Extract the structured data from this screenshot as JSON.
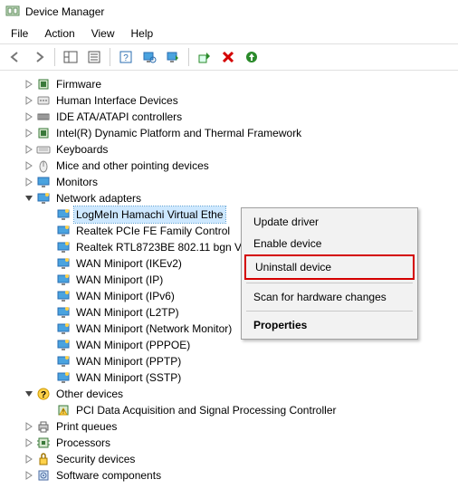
{
  "window": {
    "title": "Device Manager"
  },
  "menubar": [
    "File",
    "Action",
    "View",
    "Help"
  ],
  "tree": {
    "items": [
      {
        "label": "Firmware",
        "depth": 1,
        "icon": "chip",
        "twisty": ">"
      },
      {
        "label": "Human Interface Devices",
        "depth": 1,
        "icon": "hid",
        "twisty": ">"
      },
      {
        "label": "IDE ATA/ATAPI controllers",
        "depth": 1,
        "icon": "ide",
        "twisty": ">"
      },
      {
        "label": "Intel(R) Dynamic Platform and Thermal Framework",
        "depth": 1,
        "icon": "chip",
        "twisty": ">"
      },
      {
        "label": "Keyboards",
        "depth": 1,
        "icon": "keyboard",
        "twisty": ">"
      },
      {
        "label": "Mice and other pointing devices",
        "depth": 1,
        "icon": "mouse",
        "twisty": ">"
      },
      {
        "label": "Monitors",
        "depth": 1,
        "icon": "monitor",
        "twisty": ">"
      },
      {
        "label": "Network adapters",
        "depth": 1,
        "icon": "net",
        "twisty": "v"
      },
      {
        "label": "LogMeIn Hamachi Virtual Ethe",
        "depth": 2,
        "icon": "net",
        "twisty": "",
        "selected": true
      },
      {
        "label": "Realtek PCIe FE Family Control",
        "depth": 2,
        "icon": "net",
        "twisty": ""
      },
      {
        "label": "Realtek RTL8723BE 802.11 bgn V",
        "depth": 2,
        "icon": "net",
        "twisty": ""
      },
      {
        "label": "WAN Miniport (IKEv2)",
        "depth": 2,
        "icon": "net",
        "twisty": ""
      },
      {
        "label": "WAN Miniport (IP)",
        "depth": 2,
        "icon": "net",
        "twisty": ""
      },
      {
        "label": "WAN Miniport (IPv6)",
        "depth": 2,
        "icon": "net",
        "twisty": ""
      },
      {
        "label": "WAN Miniport (L2TP)",
        "depth": 2,
        "icon": "net",
        "twisty": ""
      },
      {
        "label": "WAN Miniport (Network Monitor)",
        "depth": 2,
        "icon": "net",
        "twisty": ""
      },
      {
        "label": "WAN Miniport (PPPOE)",
        "depth": 2,
        "icon": "net",
        "twisty": ""
      },
      {
        "label": "WAN Miniport (PPTP)",
        "depth": 2,
        "icon": "net",
        "twisty": ""
      },
      {
        "label": "WAN Miniport (SSTP)",
        "depth": 2,
        "icon": "net",
        "twisty": ""
      },
      {
        "label": "Other devices",
        "depth": 1,
        "icon": "other",
        "twisty": "v"
      },
      {
        "label": "PCI Data Acquisition and Signal Processing Controller",
        "depth": 2,
        "icon": "warn",
        "twisty": ""
      },
      {
        "label": "Print queues",
        "depth": 1,
        "icon": "printer",
        "twisty": ">"
      },
      {
        "label": "Processors",
        "depth": 1,
        "icon": "cpu",
        "twisty": ">"
      },
      {
        "label": "Security devices",
        "depth": 1,
        "icon": "security",
        "twisty": ">"
      },
      {
        "label": "Software components",
        "depth": 1,
        "icon": "soft",
        "twisty": ">"
      }
    ]
  },
  "context_menu": {
    "items": [
      {
        "label": "Update driver",
        "type": "item"
      },
      {
        "label": "Enable device",
        "type": "item"
      },
      {
        "label": "Uninstall device",
        "type": "item",
        "highlight": true
      },
      {
        "type": "sep"
      },
      {
        "label": "Scan for hardware changes",
        "type": "item"
      },
      {
        "type": "sep"
      },
      {
        "label": "Properties",
        "type": "item",
        "bold": true
      }
    ]
  }
}
